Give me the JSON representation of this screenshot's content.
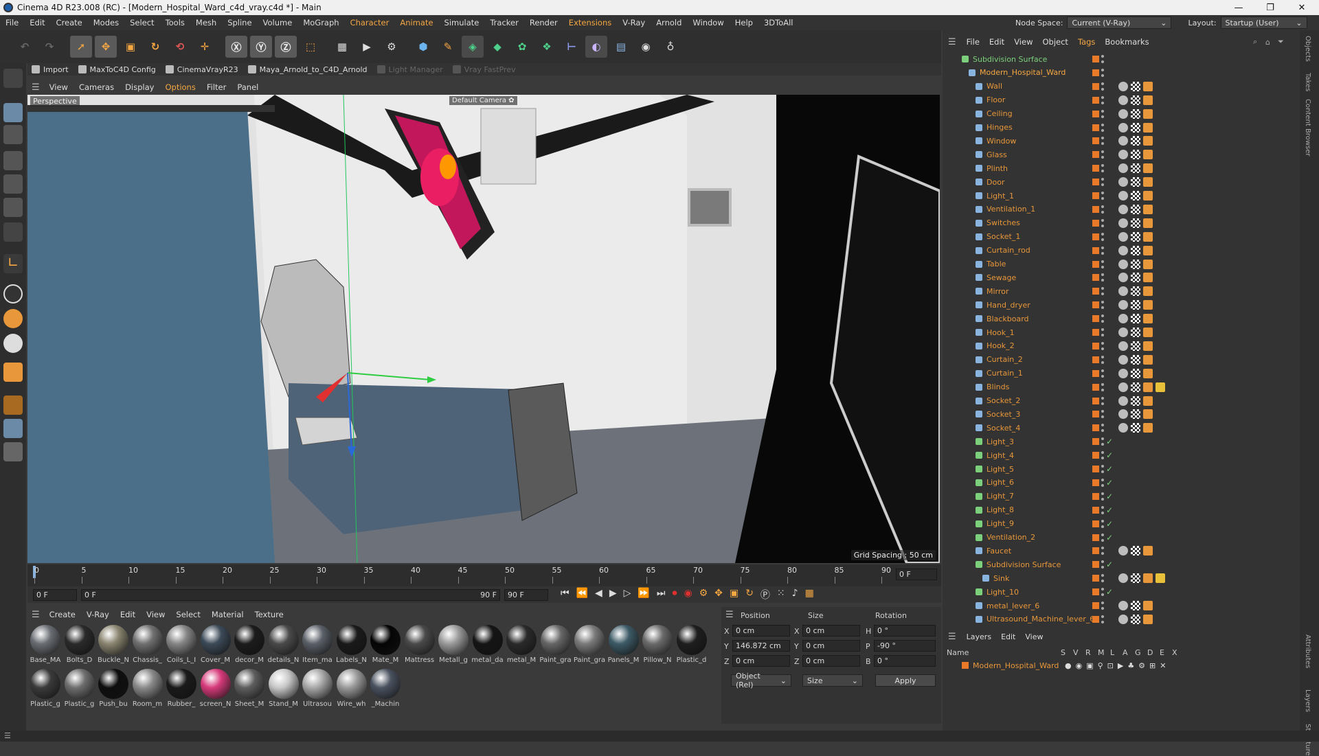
{
  "titlebar": {
    "title": "Cinema 4D R23.008 (RC) - [Modern_Hospital_Ward_c4d_vray.c4d *] - Main",
    "minimize": "—",
    "restore": "❐",
    "close": "✕"
  },
  "menu": [
    "File",
    "Edit",
    "Create",
    "Modes",
    "Select",
    "Tools",
    "Mesh",
    "Spline",
    "Volume",
    "MoGraph",
    "Character",
    "Animate",
    "Simulate",
    "Tracker",
    "Render",
    "Extensions",
    "V-Ray",
    "Arnold",
    "Window",
    "Help",
    "3DToAll"
  ],
  "menu_highlight": [
    "Character",
    "Animate",
    "Extensions"
  ],
  "nodespace": {
    "label": "Node Space:",
    "value": "Current (V-Ray)",
    "layout_label": "Layout:",
    "layout_value": "Startup (User)"
  },
  "shelf": [
    {
      "label": "Import",
      "dim": false
    },
    {
      "label": "MaxToC4D Config",
      "dim": false
    },
    {
      "label": "CinemaVrayR23",
      "dim": false
    },
    {
      "label": "Maya_Arnold_to_C4D_Arnold",
      "dim": false
    },
    {
      "label": "Light Manager",
      "dim": true
    },
    {
      "label": "Vray FastPrev",
      "dim": true
    }
  ],
  "viewport_menu": [
    "View",
    "Cameras",
    "Display",
    "Options",
    "Filter",
    "Panel"
  ],
  "viewport": {
    "name": "Perspective",
    "camera": "Default Camera ✿",
    "grid": "Grid Spacing : 50 cm"
  },
  "timeline": {
    "ticks": [
      "0",
      "5",
      "10",
      "15",
      "20",
      "25",
      "30",
      "35",
      "40",
      "45",
      "50",
      "55",
      "60",
      "65",
      "70",
      "75",
      "80",
      "85",
      "90"
    ],
    "end_field": "0 F"
  },
  "transport": {
    "start": "0 F",
    "current": "0 F",
    "end": "90 F",
    "end2": "90 F"
  },
  "material_menu": [
    "Create",
    "V-Ray",
    "Edit",
    "View",
    "Select",
    "Material",
    "Texture"
  ],
  "materials": [
    {
      "name": "Base_MA",
      "color": "#6a6e74"
    },
    {
      "name": "Bolts_D",
      "color": "#2a2a2a"
    },
    {
      "name": "Buckle_N",
      "color": "#8a8570"
    },
    {
      "name": "Chassis_",
      "color": "#707070"
    },
    {
      "name": "Coils_L_I",
      "color": "#858585"
    },
    {
      "name": "Cover_M",
      "color": "#3c4a58"
    },
    {
      "name": "decor_M",
      "color": "#1c1c1c"
    },
    {
      "name": "details_N",
      "color": "#4a4a4a"
    },
    {
      "name": "Item_ma",
      "color": "#5a6068"
    },
    {
      "name": "Labels_N",
      "color": "#1a1a1a"
    },
    {
      "name": "Mate_M",
      "color": "#050505"
    },
    {
      "name": "Mattress",
      "color": "#4a4a4a"
    },
    {
      "name": "Metall_g",
      "color": "#9a9a9a"
    },
    {
      "name": "metal_da",
      "color": "#151515"
    },
    {
      "name": "metal_M",
      "color": "#2a2a2a"
    },
    {
      "name": "Paint_gra",
      "color": "#666666"
    },
    {
      "name": "Paint_gra",
      "color": "#7a7a7a"
    },
    {
      "name": "Panels_M",
      "color": "#3c5a66"
    },
    {
      "name": "Pillow_N",
      "color": "#6a6a6a"
    },
    {
      "name": "Plastic_d",
      "color": "#1e1e1e"
    },
    {
      "name": "Plastic_g",
      "color": "#3a3a3a"
    },
    {
      "name": "Plastic_g",
      "color": "#6e6e6e"
    },
    {
      "name": "Push_bu",
      "color": "#0e0e0e"
    },
    {
      "name": "Room_m",
      "color": "#8a8a8a"
    },
    {
      "name": "Rubber_",
      "color": "#1a1a1a"
    },
    {
      "name": "screen_N",
      "color": "#d63a7a"
    },
    {
      "name": "Sheet_M",
      "color": "#5e5e5e"
    },
    {
      "name": "Stand_M",
      "color": "#c8c8c8"
    },
    {
      "name": "Ultrasou",
      "color": "#a8a8a8"
    },
    {
      "name": "Wire_wh",
      "color": "#9a9a9a"
    },
    {
      "name": "_Machin",
      "color": "#4a5260"
    }
  ],
  "coords": {
    "headers": [
      "Position",
      "Size",
      "Rotation"
    ],
    "rows": [
      {
        "axis": "X",
        "pos": "0 cm",
        "size_axis": "X",
        "size": "0 cm",
        "rot_axis": "H",
        "rot": "0 °"
      },
      {
        "axis": "Y",
        "pos": "146.872 cm",
        "size_axis": "Y",
        "size": "0 cm",
        "rot_axis": "P",
        "rot": "-90 °"
      },
      {
        "axis": "Z",
        "pos": "0 cm",
        "size_axis": "Z",
        "size": "0 cm",
        "rot_axis": "B",
        "rot": "0 °"
      }
    ],
    "mode": "Object (Rel)",
    "size_mode": "Size",
    "apply": "Apply"
  },
  "objmgr_menu": [
    "File",
    "Edit",
    "View",
    "Object",
    "Tags",
    "Bookmarks"
  ],
  "objects": [
    {
      "name": "Subdivision Surface",
      "indent": 0,
      "type": "light",
      "tags": 0,
      "check": false
    },
    {
      "name": "Modern_Hospital_Ward",
      "indent": 1,
      "type": "null",
      "tags": 0,
      "check": false
    },
    {
      "name": "Wall",
      "indent": 2,
      "type": "mesh",
      "tags": 3,
      "check": false
    },
    {
      "name": "Floor",
      "indent": 2,
      "type": "mesh",
      "tags": 3,
      "check": false
    },
    {
      "name": "Ceiling",
      "indent": 2,
      "type": "mesh",
      "tags": 3,
      "check": false
    },
    {
      "name": "Hinges",
      "indent": 2,
      "type": "mesh",
      "tags": 3,
      "check": false
    },
    {
      "name": "Window",
      "indent": 2,
      "type": "mesh",
      "tags": 3,
      "check": false
    },
    {
      "name": "Glass",
      "indent": 2,
      "type": "mesh",
      "tags": 3,
      "check": false
    },
    {
      "name": "Plinth",
      "indent": 2,
      "type": "mesh",
      "tags": 3,
      "check": false
    },
    {
      "name": "Door",
      "indent": 2,
      "type": "mesh",
      "tags": 3,
      "check": false
    },
    {
      "name": "Light_1",
      "indent": 2,
      "type": "mesh",
      "tags": 3,
      "check": false
    },
    {
      "name": "Ventilation_1",
      "indent": 2,
      "type": "mesh",
      "tags": 3,
      "check": false
    },
    {
      "name": "Switches",
      "indent": 2,
      "type": "mesh",
      "tags": 3,
      "check": false
    },
    {
      "name": "Socket_1",
      "indent": 2,
      "type": "mesh",
      "tags": 3,
      "check": false
    },
    {
      "name": "Curtain_rod",
      "indent": 2,
      "type": "mesh",
      "tags": 3,
      "check": false
    },
    {
      "name": "Table",
      "indent": 2,
      "type": "mesh",
      "tags": 3,
      "check": false
    },
    {
      "name": "Sewage",
      "indent": 2,
      "type": "mesh",
      "tags": 3,
      "check": false
    },
    {
      "name": "Mirror",
      "indent": 2,
      "type": "mesh",
      "tags": 3,
      "check": false
    },
    {
      "name": "Hand_dryer",
      "indent": 2,
      "type": "mesh",
      "tags": 3,
      "check": false
    },
    {
      "name": "Blackboard",
      "indent": 2,
      "type": "mesh",
      "tags": 3,
      "check": false
    },
    {
      "name": "Hook_1",
      "indent": 2,
      "type": "mesh",
      "tags": 3,
      "check": false
    },
    {
      "name": "Hook_2",
      "indent": 2,
      "type": "mesh",
      "tags": 3,
      "check": false
    },
    {
      "name": "Curtain_2",
      "indent": 2,
      "type": "mesh",
      "tags": 3,
      "check": false
    },
    {
      "name": "Curtain_1",
      "indent": 2,
      "type": "mesh",
      "tags": 3,
      "check": false
    },
    {
      "name": "Blinds",
      "indent": 2,
      "type": "mesh",
      "tags": 4,
      "check": false
    },
    {
      "name": "Socket_2",
      "indent": 2,
      "type": "mesh",
      "tags": 3,
      "check": false
    },
    {
      "name": "Socket_3",
      "indent": 2,
      "type": "mesh",
      "tags": 3,
      "check": false
    },
    {
      "name": "Socket_4",
      "indent": 2,
      "type": "mesh",
      "tags": 3,
      "check": false
    },
    {
      "name": "Light_3",
      "indent": 2,
      "type": "light",
      "tags": 0,
      "check": true
    },
    {
      "name": "Light_4",
      "indent": 2,
      "type": "light",
      "tags": 0,
      "check": true
    },
    {
      "name": "Light_5",
      "indent": 2,
      "type": "light",
      "tags": 0,
      "check": true
    },
    {
      "name": "Light_6",
      "indent": 2,
      "type": "light",
      "tags": 0,
      "check": true
    },
    {
      "name": "Light_7",
      "indent": 2,
      "type": "light",
      "tags": 0,
      "check": true
    },
    {
      "name": "Light_8",
      "indent": 2,
      "type": "light",
      "tags": 0,
      "check": true
    },
    {
      "name": "Light_9",
      "indent": 2,
      "type": "light",
      "tags": 0,
      "check": true
    },
    {
      "name": "Ventilation_2",
      "indent": 2,
      "type": "light",
      "tags": 0,
      "check": true
    },
    {
      "name": "Faucet",
      "indent": 2,
      "type": "mesh",
      "tags": 3,
      "check": false
    },
    {
      "name": "Subdivision Surface",
      "indent": 2,
      "type": "light",
      "tags": 0,
      "check": true
    },
    {
      "name": "Sink",
      "indent": 3,
      "type": "mesh",
      "tags": 4,
      "check": false
    },
    {
      "name": "Light_10",
      "indent": 2,
      "type": "light",
      "tags": 0,
      "check": true
    },
    {
      "name": "metal_lever_6",
      "indent": 2,
      "type": "mesh",
      "tags": 3,
      "check": false
    },
    {
      "name": "Ultrasound_Machine_lever_6",
      "indent": 2,
      "type": "mesh",
      "tags": 3,
      "check": false
    }
  ],
  "layers": {
    "menu": [
      "Layers",
      "Edit",
      "View"
    ],
    "columns": [
      "Name",
      "S",
      "V",
      "R",
      "M",
      "L",
      "A",
      "G",
      "D",
      "E",
      "X"
    ],
    "row": "Modern_Hospital_Ward"
  },
  "right_tabs": [
    "Objects",
    "Takes",
    "Content Browser",
    "Attributes",
    "Layers",
    "Structure"
  ],
  "colors": {
    "accent": "#f5a742",
    "object_name": "#e8973a",
    "vis_dot": "#e87a2a",
    "check": "#7cd07c"
  }
}
